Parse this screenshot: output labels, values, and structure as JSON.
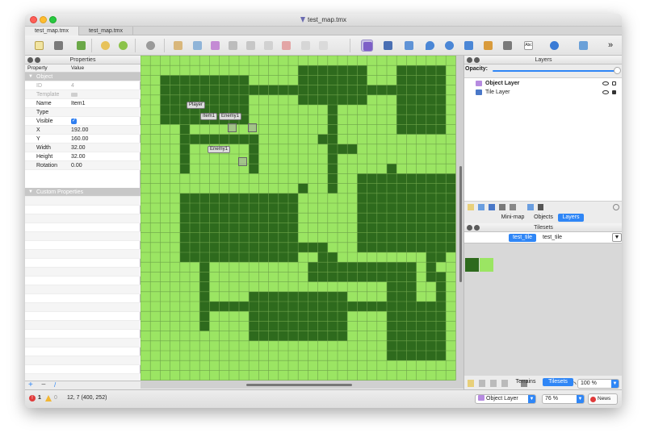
{
  "window": {
    "title": "test_map.tmx",
    "tabs": [
      "test_map.tmx",
      "test_map.tmx"
    ]
  },
  "toolbar": {
    "overflow_label": "»",
    "text_tool_label": "Abc",
    "icons": [
      "new-document",
      "save",
      "export",
      "undo",
      "redo",
      "random-mode",
      "stamp-brush",
      "terrain-brush",
      "wang-brush",
      "bucket-fill",
      "shape-fill",
      "eraser",
      "rect-select",
      "magic-wand",
      "select-same",
      "select-objects",
      "edit-polygons",
      "insert-rectangle",
      "insert-point",
      "insert-ellipse",
      "insert-polygon",
      "insert-tile",
      "insert-template",
      "insert-text",
      "move",
      "flip"
    ]
  },
  "properties": {
    "panel_title": "Properties",
    "col_property": "Property",
    "col_value": "Value",
    "group_object": "Object",
    "group_custom": "Custom Properties",
    "rows": [
      {
        "key": "ID",
        "value": "4",
        "dim": true
      },
      {
        "key": "Template",
        "value": "",
        "dim": true
      },
      {
        "key": "Name",
        "value": "Item1",
        "dim": false
      },
      {
        "key": "Type",
        "value": "",
        "dim": false
      },
      {
        "key": "Visible",
        "value": "",
        "dim": false,
        "checkbox": true
      },
      {
        "key": "X",
        "value": "192.00",
        "dim": false
      },
      {
        "key": "Y",
        "value": "160.00",
        "dim": false
      },
      {
        "key": "Width",
        "value": "32.00",
        "dim": false
      },
      {
        "key": "Height",
        "value": "32.00",
        "dim": false
      },
      {
        "key": "Rotation",
        "value": "0.00",
        "dim": false
      }
    ],
    "footer_add": "+",
    "footer_remove": "−",
    "footer_edit": "/"
  },
  "map": {
    "colors": {
      "grass": "#9be563",
      "forest": "#2e6a1d",
      "grid": "#6ea34a"
    },
    "objects": [
      {
        "label": "Player"
      },
      {
        "label": "Item1"
      },
      {
        "label": "Enemy1"
      },
      {
        "label": "Enemy1"
      }
    ]
  },
  "layers": {
    "panel_title": "Layers",
    "opacity_label": "Opacity:",
    "items": [
      {
        "name": "Object Layer",
        "selected": true
      },
      {
        "name": "Tile Layer",
        "selected": false
      }
    ],
    "tabs": [
      "Mini-map",
      "Objects",
      "Layers"
    ],
    "active_tab": "Layers"
  },
  "tilesets": {
    "panel_title": "Tilesets",
    "tabs": [
      "test_tile",
      "test_tile"
    ],
    "zoom": "100 %",
    "bottom_tabs": [
      "Terrains",
      "Tilesets"
    ],
    "active_bottom": "Tilesets"
  },
  "status": {
    "errors": "1",
    "warnings": "0",
    "coords": "12, 7 (400, 252)",
    "layer": "Object Layer",
    "zoom": "76 %",
    "news": "News"
  },
  "accent": "#2f86f6"
}
